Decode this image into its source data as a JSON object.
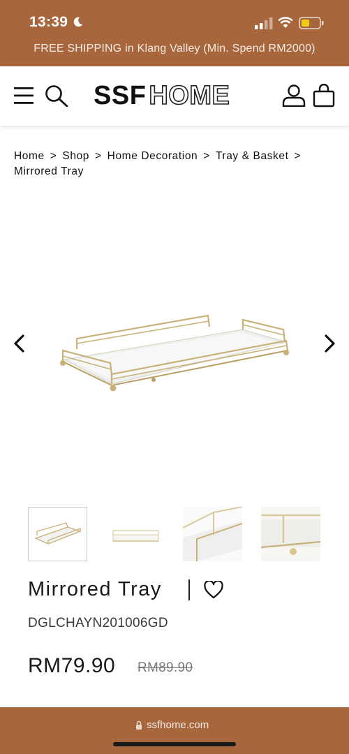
{
  "status_bar": {
    "time": "13:39",
    "icons": [
      "moon-icon",
      "signal-icon",
      "wifi-icon",
      "battery-icon"
    ]
  },
  "promo": {
    "text": "FREE SHIPPING in Klang Valley (Min. Spend RM2000)"
  },
  "header": {
    "brand_bold": "SSF",
    "brand_outline": "HOME",
    "icons": [
      "menu-icon",
      "search-icon",
      "account-icon",
      "cart-icon"
    ]
  },
  "breadcrumb": {
    "items": [
      "Home",
      "Shop",
      "Home Decoration",
      "Tray & Basket",
      "Mirrored Tray"
    ],
    "separator": ">"
  },
  "product": {
    "title": "Mirrored Tray",
    "sku": "DGLCHAYN201006GD",
    "price": "RM79.90",
    "old_price": "RM89.90"
  },
  "gallery": {
    "thumbnail_count": 4,
    "selected_index": 0
  },
  "browser": {
    "url": "ssfhome.com"
  },
  "colors": {
    "brand_brown": "#a8663d",
    "gold": "#c8b27a",
    "text": "#1a1a1a"
  }
}
